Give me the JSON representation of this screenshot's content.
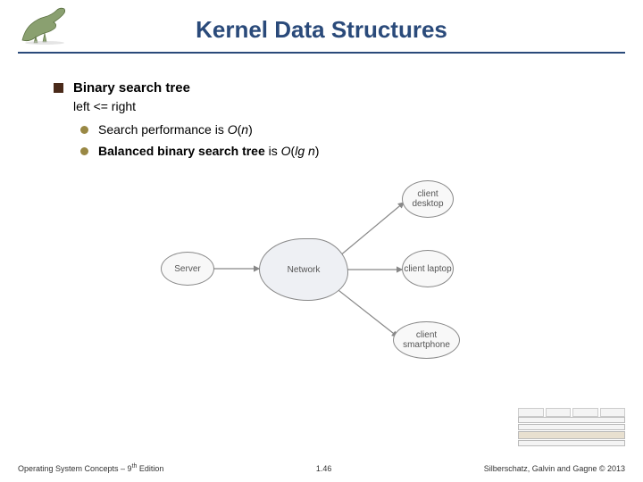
{
  "header": {
    "title": "Kernel Data Structures"
  },
  "bullets": {
    "main_bold": "Binary search tree",
    "main_sub": "left <= right",
    "sub1_pre": "Search performance is ",
    "sub1_ital": "O",
    "sub1_post": "(",
    "sub1_ital2": "n",
    "sub1_end": ")",
    "sub2_bold": "Balanced binary search tree",
    "sub2_post": " is ",
    "sub2_ital": "O",
    "sub2_p1": "(",
    "sub2_ital2": "lg n",
    "sub2_end": ")"
  },
  "diagram": {
    "server": "Server",
    "network": "Network",
    "client1": "client desktop",
    "client2": "client laptop",
    "client3": "client smartphone"
  },
  "footer": {
    "left_pre": "Operating System Concepts – 9",
    "left_sup": "th",
    "left_post": " Edition",
    "center": "1.46",
    "right": "Silberschatz, Galvin and Gagne © 2013"
  }
}
